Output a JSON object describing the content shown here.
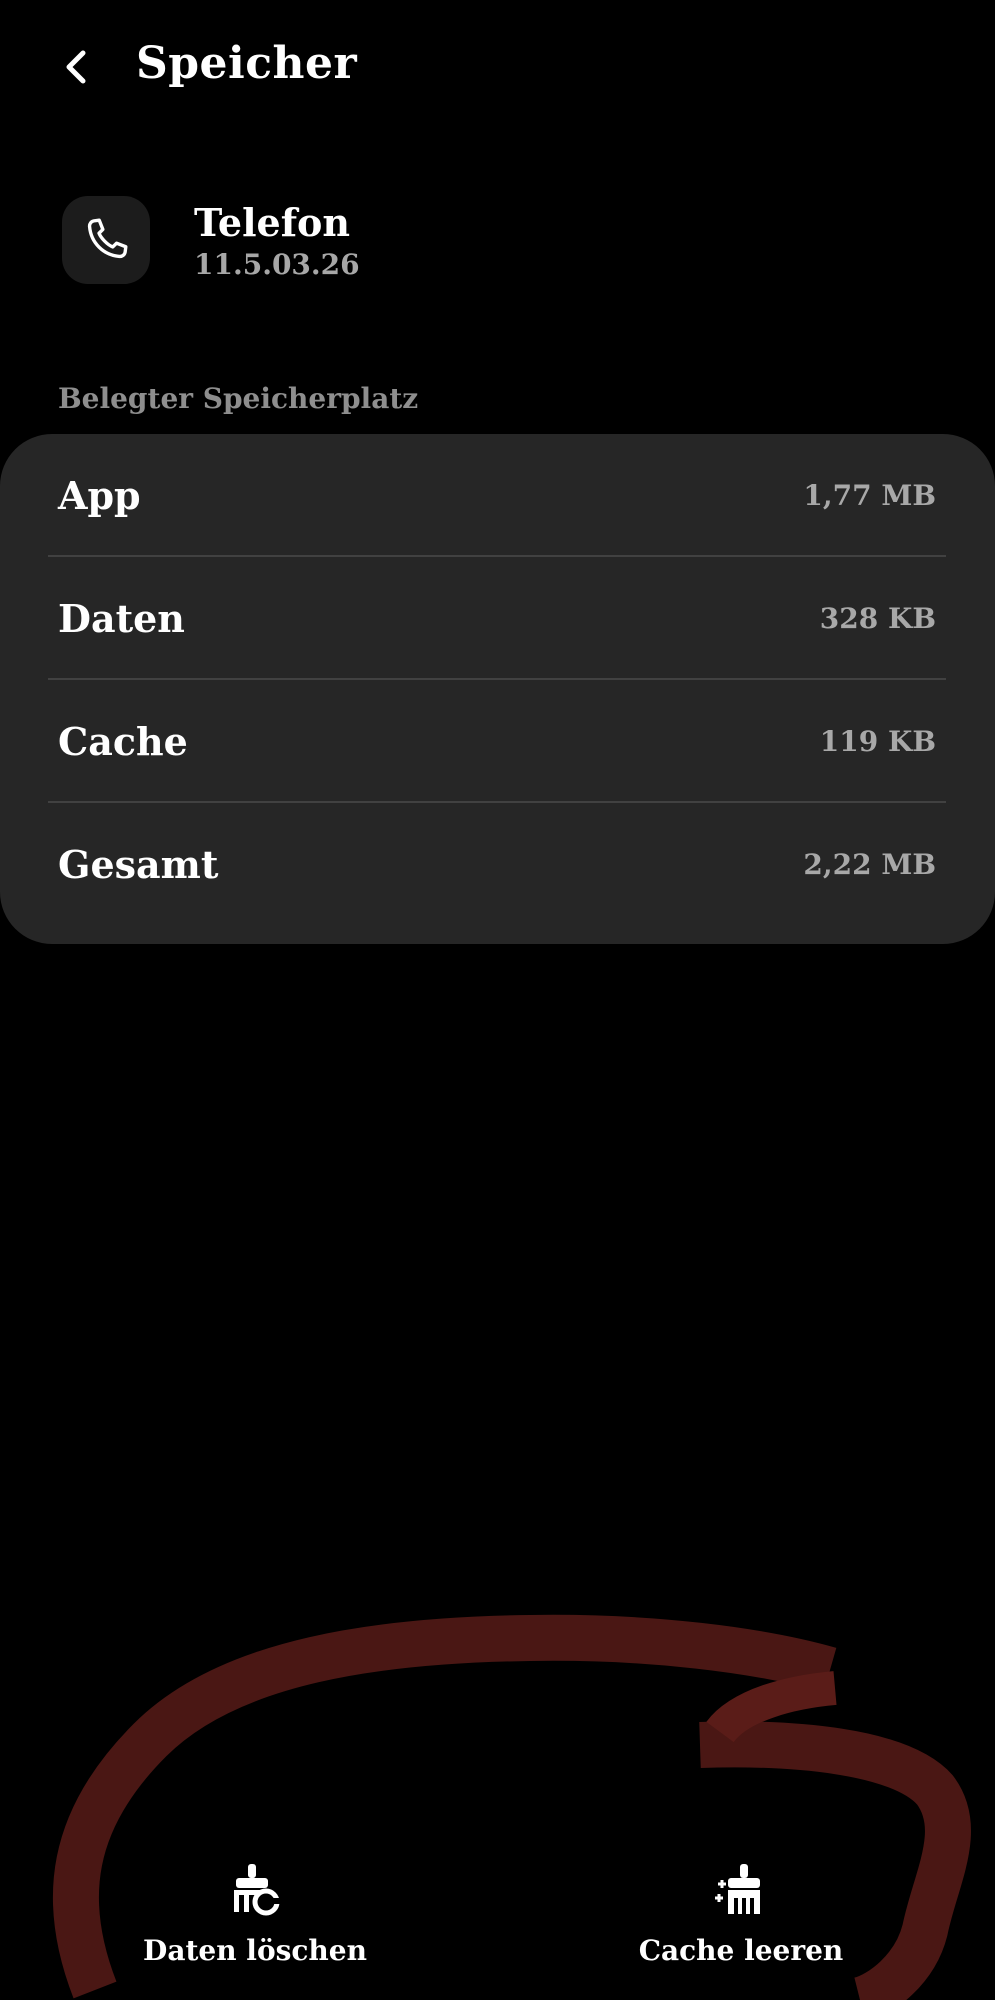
{
  "header": {
    "title": "Speicher",
    "back_icon": "chevron-left-icon"
  },
  "app": {
    "name": "Telefon",
    "version": "11.5.03.26",
    "icon": "phone-icon"
  },
  "storage": {
    "section_label": "Belegter Speicherplatz",
    "rows": [
      {
        "label": "App",
        "value": "1,77 MB"
      },
      {
        "label": "Daten",
        "value": "328 KB"
      },
      {
        "label": "Cache",
        "value": "119 KB"
      },
      {
        "label": "Gesamt",
        "value": "2,22 MB"
      }
    ]
  },
  "actions": {
    "clear_data": {
      "label": "Daten löschen",
      "icon": "clear-data-icon"
    },
    "clear_cache": {
      "label": "Cache leeren",
      "icon": "clear-cache-icon"
    }
  },
  "colors": {
    "background": "#000000",
    "card": "#262626",
    "secondary_text": "#a8a8a8",
    "annotation_stroke": "#4a1714"
  }
}
